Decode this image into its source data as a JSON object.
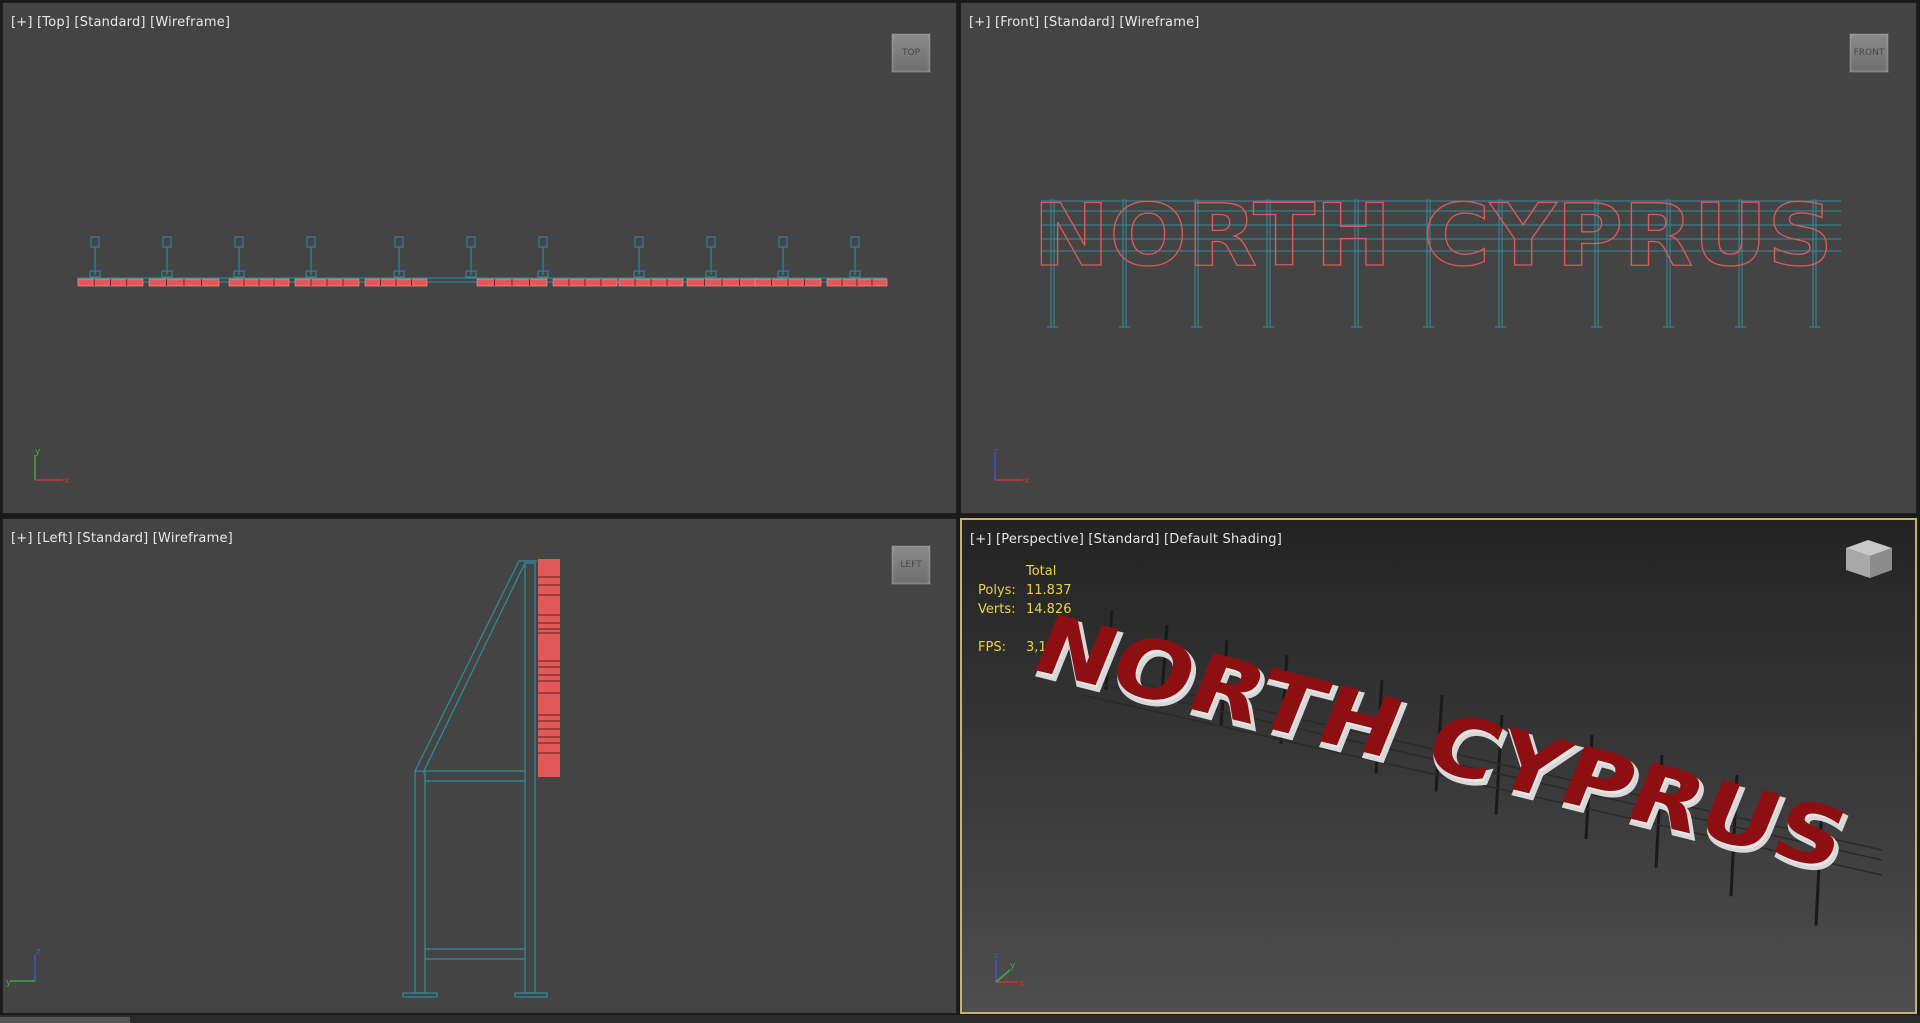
{
  "viewports": {
    "top": {
      "plus": "[+]",
      "view": "[Top]",
      "mode": "[Standard]",
      "shading": "[Wireframe]",
      "cube": "TOP"
    },
    "front": {
      "plus": "[+]",
      "view": "[Front]",
      "mode": "[Standard]",
      "shading": "[Wireframe]",
      "cube": "FRONT",
      "text": "NORTH CYPRUS"
    },
    "left": {
      "plus": "[+]",
      "view": "[Left]",
      "mode": "[Standard]",
      "shading": "[Wireframe]",
      "cube": "LEFT"
    },
    "perspective": {
      "plus": "[+]",
      "view": "[Perspective]",
      "mode": "[Standard]",
      "shading": "[Default Shading]",
      "text": "NORTH CYPRUS"
    }
  },
  "stats": {
    "header": "Total",
    "polys_label": "Polys:",
    "polys_value": "11.837",
    "verts_label": "Verts:",
    "verts_value": "14.826",
    "fps_label": "FPS:",
    "fps_value": "3,120"
  },
  "axes": {
    "x": "x",
    "y": "y",
    "z": "z"
  },
  "colors": {
    "wire_blue": "#2e8fa3",
    "wire_red": "#e05858",
    "sign_red": "#8e0f12",
    "active_border": "#c9b26a",
    "stats_text": "#e8d34a"
  }
}
